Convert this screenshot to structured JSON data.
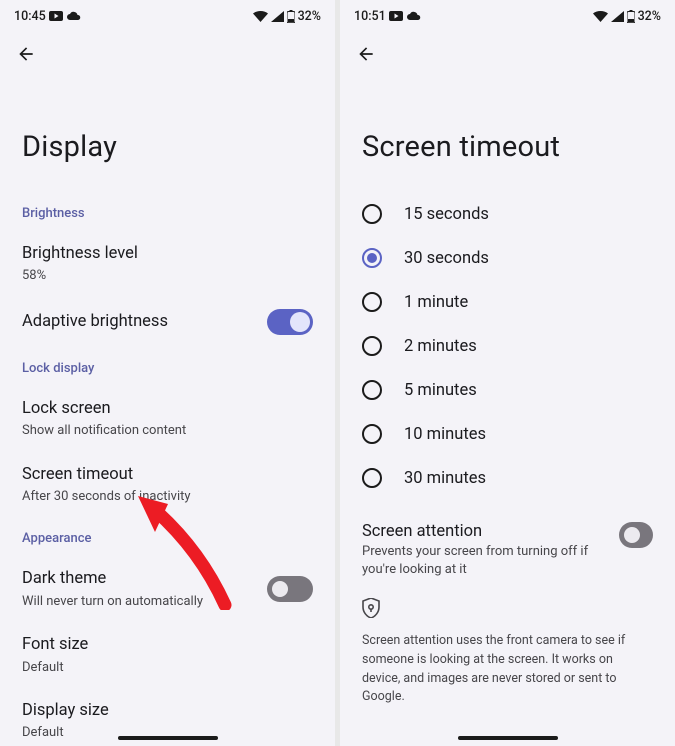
{
  "left": {
    "status": {
      "time": "10:45",
      "battery": "32%"
    },
    "title": "Display",
    "sections": {
      "brightness": {
        "label": "Brightness",
        "level": {
          "title": "Brightness level",
          "sub": "58%"
        },
        "adaptive": {
          "title": "Adaptive brightness",
          "on": true
        }
      },
      "lock": {
        "label": "Lock display",
        "lockscreen": {
          "title": "Lock screen",
          "sub": "Show all notification content"
        },
        "timeout": {
          "title": "Screen timeout",
          "sub": "After 30 seconds of inactivity"
        }
      },
      "appearance": {
        "label": "Appearance",
        "dark": {
          "title": "Dark theme",
          "sub": "Will never turn on automatically",
          "on": false
        },
        "font": {
          "title": "Font size",
          "sub": "Default"
        },
        "dispsize": {
          "title": "Display size",
          "sub": "Default"
        }
      }
    }
  },
  "right": {
    "status": {
      "time": "10:51",
      "battery": "32%"
    },
    "title": "Screen timeout",
    "options": [
      {
        "label": "15 seconds",
        "selected": false
      },
      {
        "label": "30 seconds",
        "selected": true
      },
      {
        "label": "1 minute",
        "selected": false
      },
      {
        "label": "2 minutes",
        "selected": false
      },
      {
        "label": "5 minutes",
        "selected": false
      },
      {
        "label": "10 minutes",
        "selected": false
      },
      {
        "label": "30 minutes",
        "selected": false
      }
    ],
    "screen_attention": {
      "title": "Screen attention",
      "sub": "Prevents your screen from turning off if you're looking at it",
      "on": false
    },
    "footnote": "Screen attention uses the front camera to see if someone is looking at the screen. It works on device, and images are never stored or sent to Google."
  }
}
